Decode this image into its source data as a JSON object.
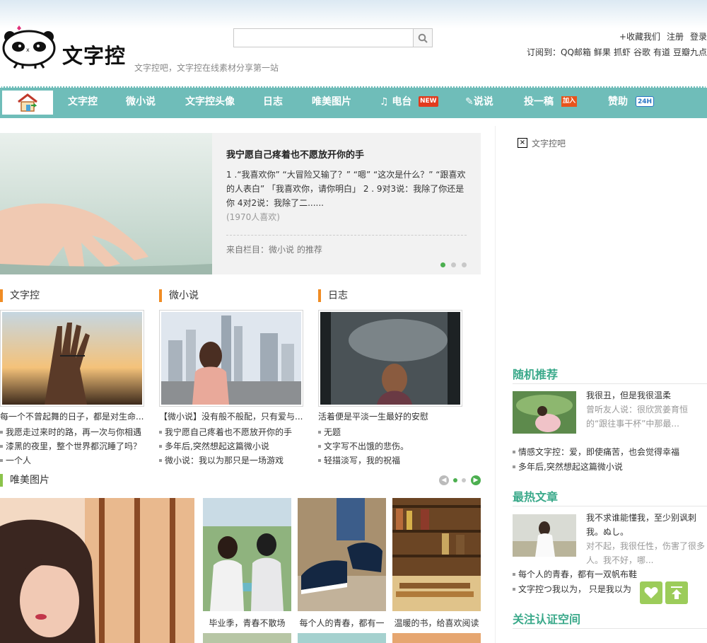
{
  "header": {
    "logo_text": "文字控",
    "slogan": "文字控吧，文字控在线素材分享第一站",
    "search": {
      "placeholder": ""
    },
    "toplinks": [
      "+收藏我们",
      "注册",
      "登录"
    ],
    "subscribe_label": "订阅到：",
    "subscribe_links": [
      "QQ邮箱",
      "鲜果",
      "抓虾",
      "谷歌",
      "有道",
      "豆瓣九点"
    ]
  },
  "nav": {
    "items": [
      {
        "label": "文字控"
      },
      {
        "label": "微小说"
      },
      {
        "label": "文字控头像"
      },
      {
        "label": "日志"
      },
      {
        "label": "唯美图片"
      },
      {
        "label": "♫ 电台",
        "badge": "NEW"
      },
      {
        "label": "✎说说"
      },
      {
        "label": "投一稿",
        "badge": "加入"
      },
      {
        "label": "赞助",
        "badge": "24H"
      }
    ]
  },
  "slider": {
    "title": "我宁愿自己疼着也不愿放开你的手",
    "desc": "1 .“我喜欢你” “大冒险又输了？” “嗯” “这次是什么？” “跟喜欢的人表白” 「我喜欢你，请你明白」 2 . 9对3说：我除了你还是你 4对2说：我除了二......",
    "count": "(1970人喜欢)",
    "from": "来自栏目：微小说 的推荐"
  },
  "sections": [
    {
      "title": "文字控",
      "caption": "每一个不曾起舞的日子，都是对生命...",
      "items": [
        "我愿走过来时的路，再一次与你相遇",
        "漆黑的夜里，整个世界都沉睡了吗？",
        "一个人"
      ]
    },
    {
      "title": "微小说",
      "caption": "【微小说】没有般不般配，只有爱与...",
      "items": [
        "我宁愿自己疼着也不愿放开你的手",
        "多年后,突然想起这篇微小说",
        "微小说：我以为那只是一场游戏"
      ]
    },
    {
      "title": "日志",
      "caption": "活着便是平淡一生最好的安慰",
      "items": [
        "无题",
        "文字写不出饿的悲伤。",
        "轻描淡写，我的祝福"
      ]
    }
  ],
  "gallery": {
    "title": "唯美图片",
    "captions": [
      "毕业季，青春不散场",
      "每个人的青春，都有一",
      "温暖的书，给喜欢阅读"
    ]
  },
  "sidebar": {
    "ad_label": "文字控吧",
    "random": {
      "title": "随机推荐",
      "feature_title": "我很丑，但是我很温柔",
      "feature_desc": "曾听友人说：很欣赏姜育恒的“跟往事干杯”中那最...",
      "items": [
        "情感文字控：爱，即使痛苦，也会觉得幸福",
        "多年后,突然想起这篇微小说"
      ]
    },
    "hot": {
      "title": "最热文章",
      "feature_title": "我不求谁能懂我，至少别讽刺我。ぬし。",
      "feature_desc": "对不起，我很任性，伤害了很多人。我不好，哪...",
      "items": [
        "每个人的青春，都有一双帆布鞋",
        "文字控つ我以为， 只是我以为"
      ]
    },
    "follow_title": "关注认证空间"
  },
  "colors": {
    "nav_bg": "#6fbdb9",
    "accent_green": "#3aa98a",
    "section_bar": "#f08c24"
  }
}
